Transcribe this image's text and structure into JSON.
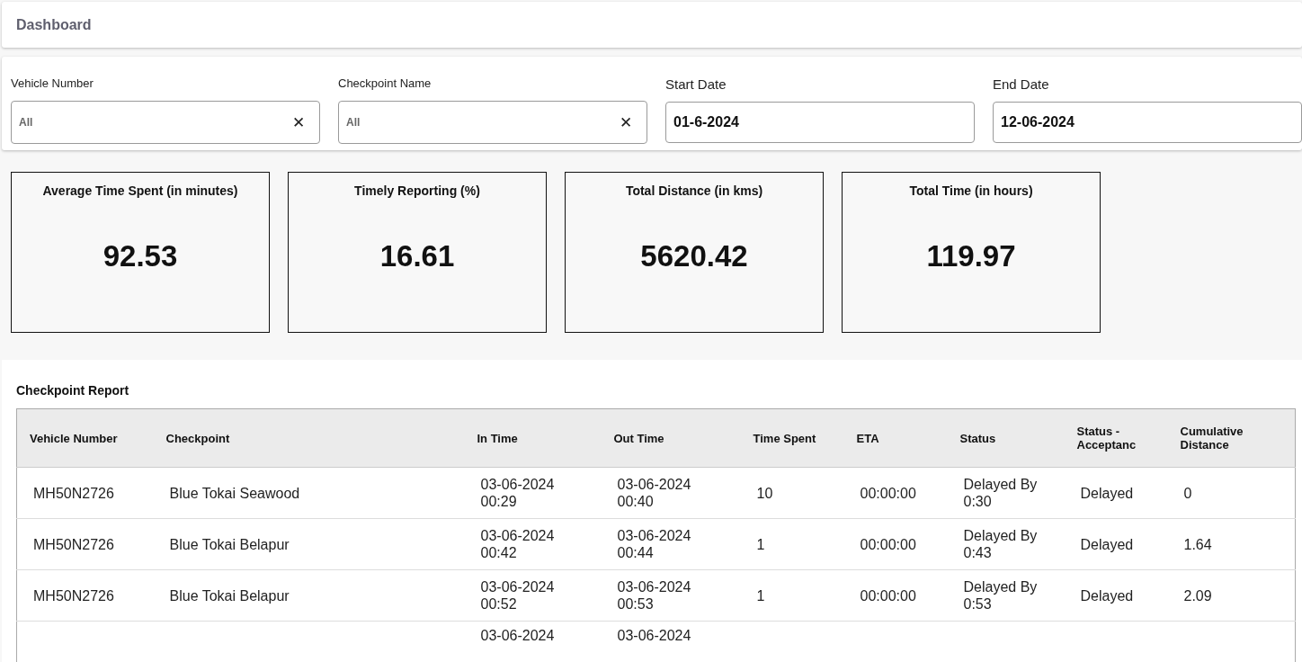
{
  "header": {
    "title": "Dashboard"
  },
  "filters": [
    {
      "kind": "select",
      "label": "Vehicle Number",
      "placeholder": "All",
      "clear": "✕"
    },
    {
      "kind": "select",
      "label": "Checkpoint Name",
      "placeholder": "All",
      "clear": "✕"
    },
    {
      "kind": "date",
      "label": "Start Date",
      "value": "01-6-2024"
    },
    {
      "kind": "date",
      "label": "End Date",
      "value": "12-06-2024"
    }
  ],
  "stats": [
    {
      "title": "Average Time Spent (in minutes)",
      "value": "92.53"
    },
    {
      "title": "Timely Reporting (%)",
      "value": "16.61"
    },
    {
      "title": "Total Distance (in kms)",
      "value": "5620.42"
    },
    {
      "title": "Total Time (in hours)",
      "value": "119.97"
    }
  ],
  "report": {
    "title": "Checkpoint Report",
    "columns": [
      "Vehicle Number",
      "Checkpoint",
      "In Time",
      "Out Time",
      "Time Spent",
      "ETA",
      "Status",
      "Status - Acceptanc",
      "Cumulative Distance"
    ],
    "rows": [
      [
        "MH50N2726",
        "Blue Tokai Seawood",
        "03-06-2024 00:29",
        "03-06-2024 00:40",
        "10",
        "00:00:00",
        "Delayed By 0:30",
        "Delayed",
        "0"
      ],
      [
        "MH50N2726",
        "Blue Tokai Belapur",
        "03-06-2024 00:42",
        "03-06-2024 00:44",
        "1",
        "00:00:00",
        "Delayed By 0:43",
        "Delayed",
        "1.64"
      ],
      [
        "MH50N2726",
        "Blue Tokai Belapur",
        "03-06-2024 00:52",
        "03-06-2024 00:53",
        "1",
        "00:00:00",
        "Delayed By 0:53",
        "Delayed",
        "2.09"
      ],
      [
        "",
        "",
        "03-06-2024",
        "03-06-2024",
        "",
        "",
        "",
        "",
        ""
      ]
    ]
  }
}
